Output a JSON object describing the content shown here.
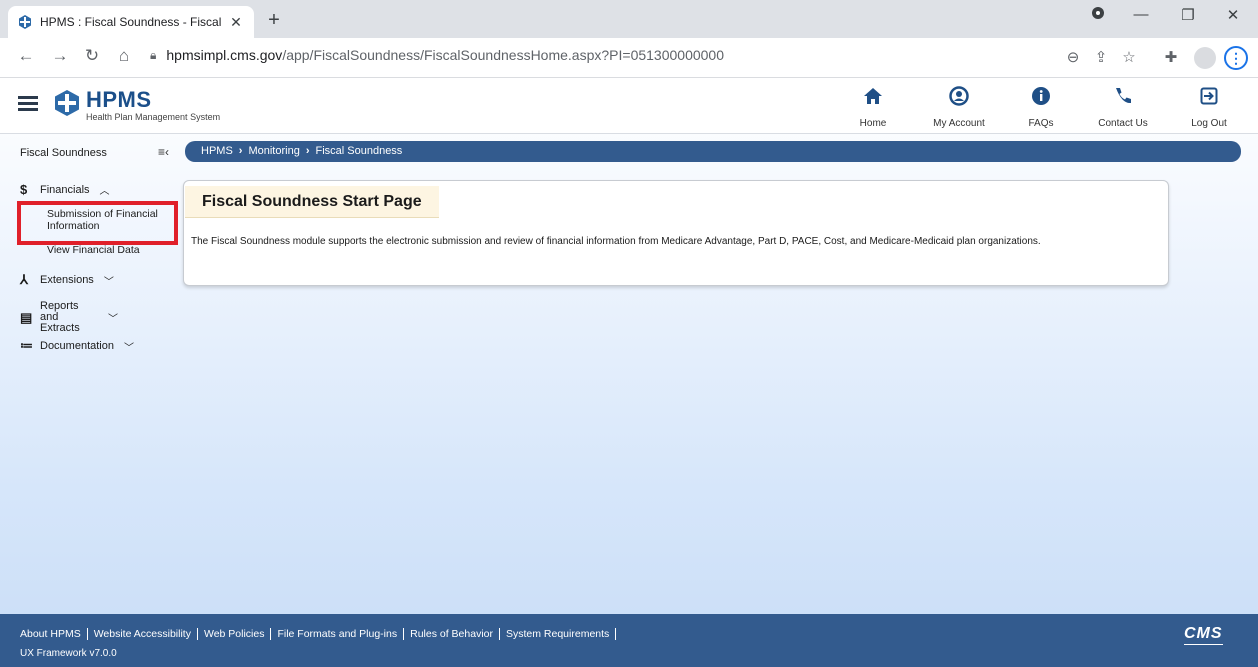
{
  "browser": {
    "tab_title": "HPMS : Fiscal Soundness - Fiscal",
    "tab_close": "✕",
    "new_tab": "+",
    "url_host": "hpmsimpl.cms.gov",
    "url_path": "/app/FiscalSoundness/FiscalSoundnessHome.aspx?PI=051300000000"
  },
  "app": {
    "logo_title": "HPMS",
    "logo_subtitle": "Health Plan Management System",
    "nav": [
      {
        "label": "Home",
        "icon": "home-icon"
      },
      {
        "label": "My Account",
        "icon": "account-icon"
      },
      {
        "label": "FAQs",
        "icon": "info-icon"
      },
      {
        "label": "Contact Us",
        "icon": "phone-icon"
      },
      {
        "label": "Log Out",
        "icon": "logout-icon"
      }
    ]
  },
  "sidebar": {
    "section_title": "Fiscal Soundness",
    "items": [
      {
        "label": "Financials",
        "icon": "dollar-icon"
      },
      {
        "label": "Submission of Financial Information"
      },
      {
        "label": "View Financial Data"
      },
      {
        "label": "Extensions",
        "icon": "fork-icon"
      },
      {
        "label": "Reports and Extracts",
        "icon": "clipboard-icon"
      },
      {
        "label": "Documentation",
        "icon": "list-icon"
      }
    ]
  },
  "breadcrumb": {
    "items": [
      "HPMS",
      "Monitoring",
      "Fiscal Soundness"
    ]
  },
  "main": {
    "title": "Fiscal Soundness Start Page",
    "description": "The Fiscal Soundness module supports the electronic submission and review of financial information from Medicare Advantage, Part D, PACE, Cost, and Medicare-Medicaid plan organizations."
  },
  "footer": {
    "links": [
      "About HPMS",
      "Website Accessibility",
      "Web Policies",
      "File Formats and Plug-ins",
      "Rules of Behavior",
      "System Requirements"
    ],
    "version": "UX Framework v7.0.0",
    "logo": "CMS"
  },
  "colors": {
    "brand_blue": "#335b8e",
    "highlight_red": "#e0202a",
    "title_bg": "#fdf5e2"
  }
}
